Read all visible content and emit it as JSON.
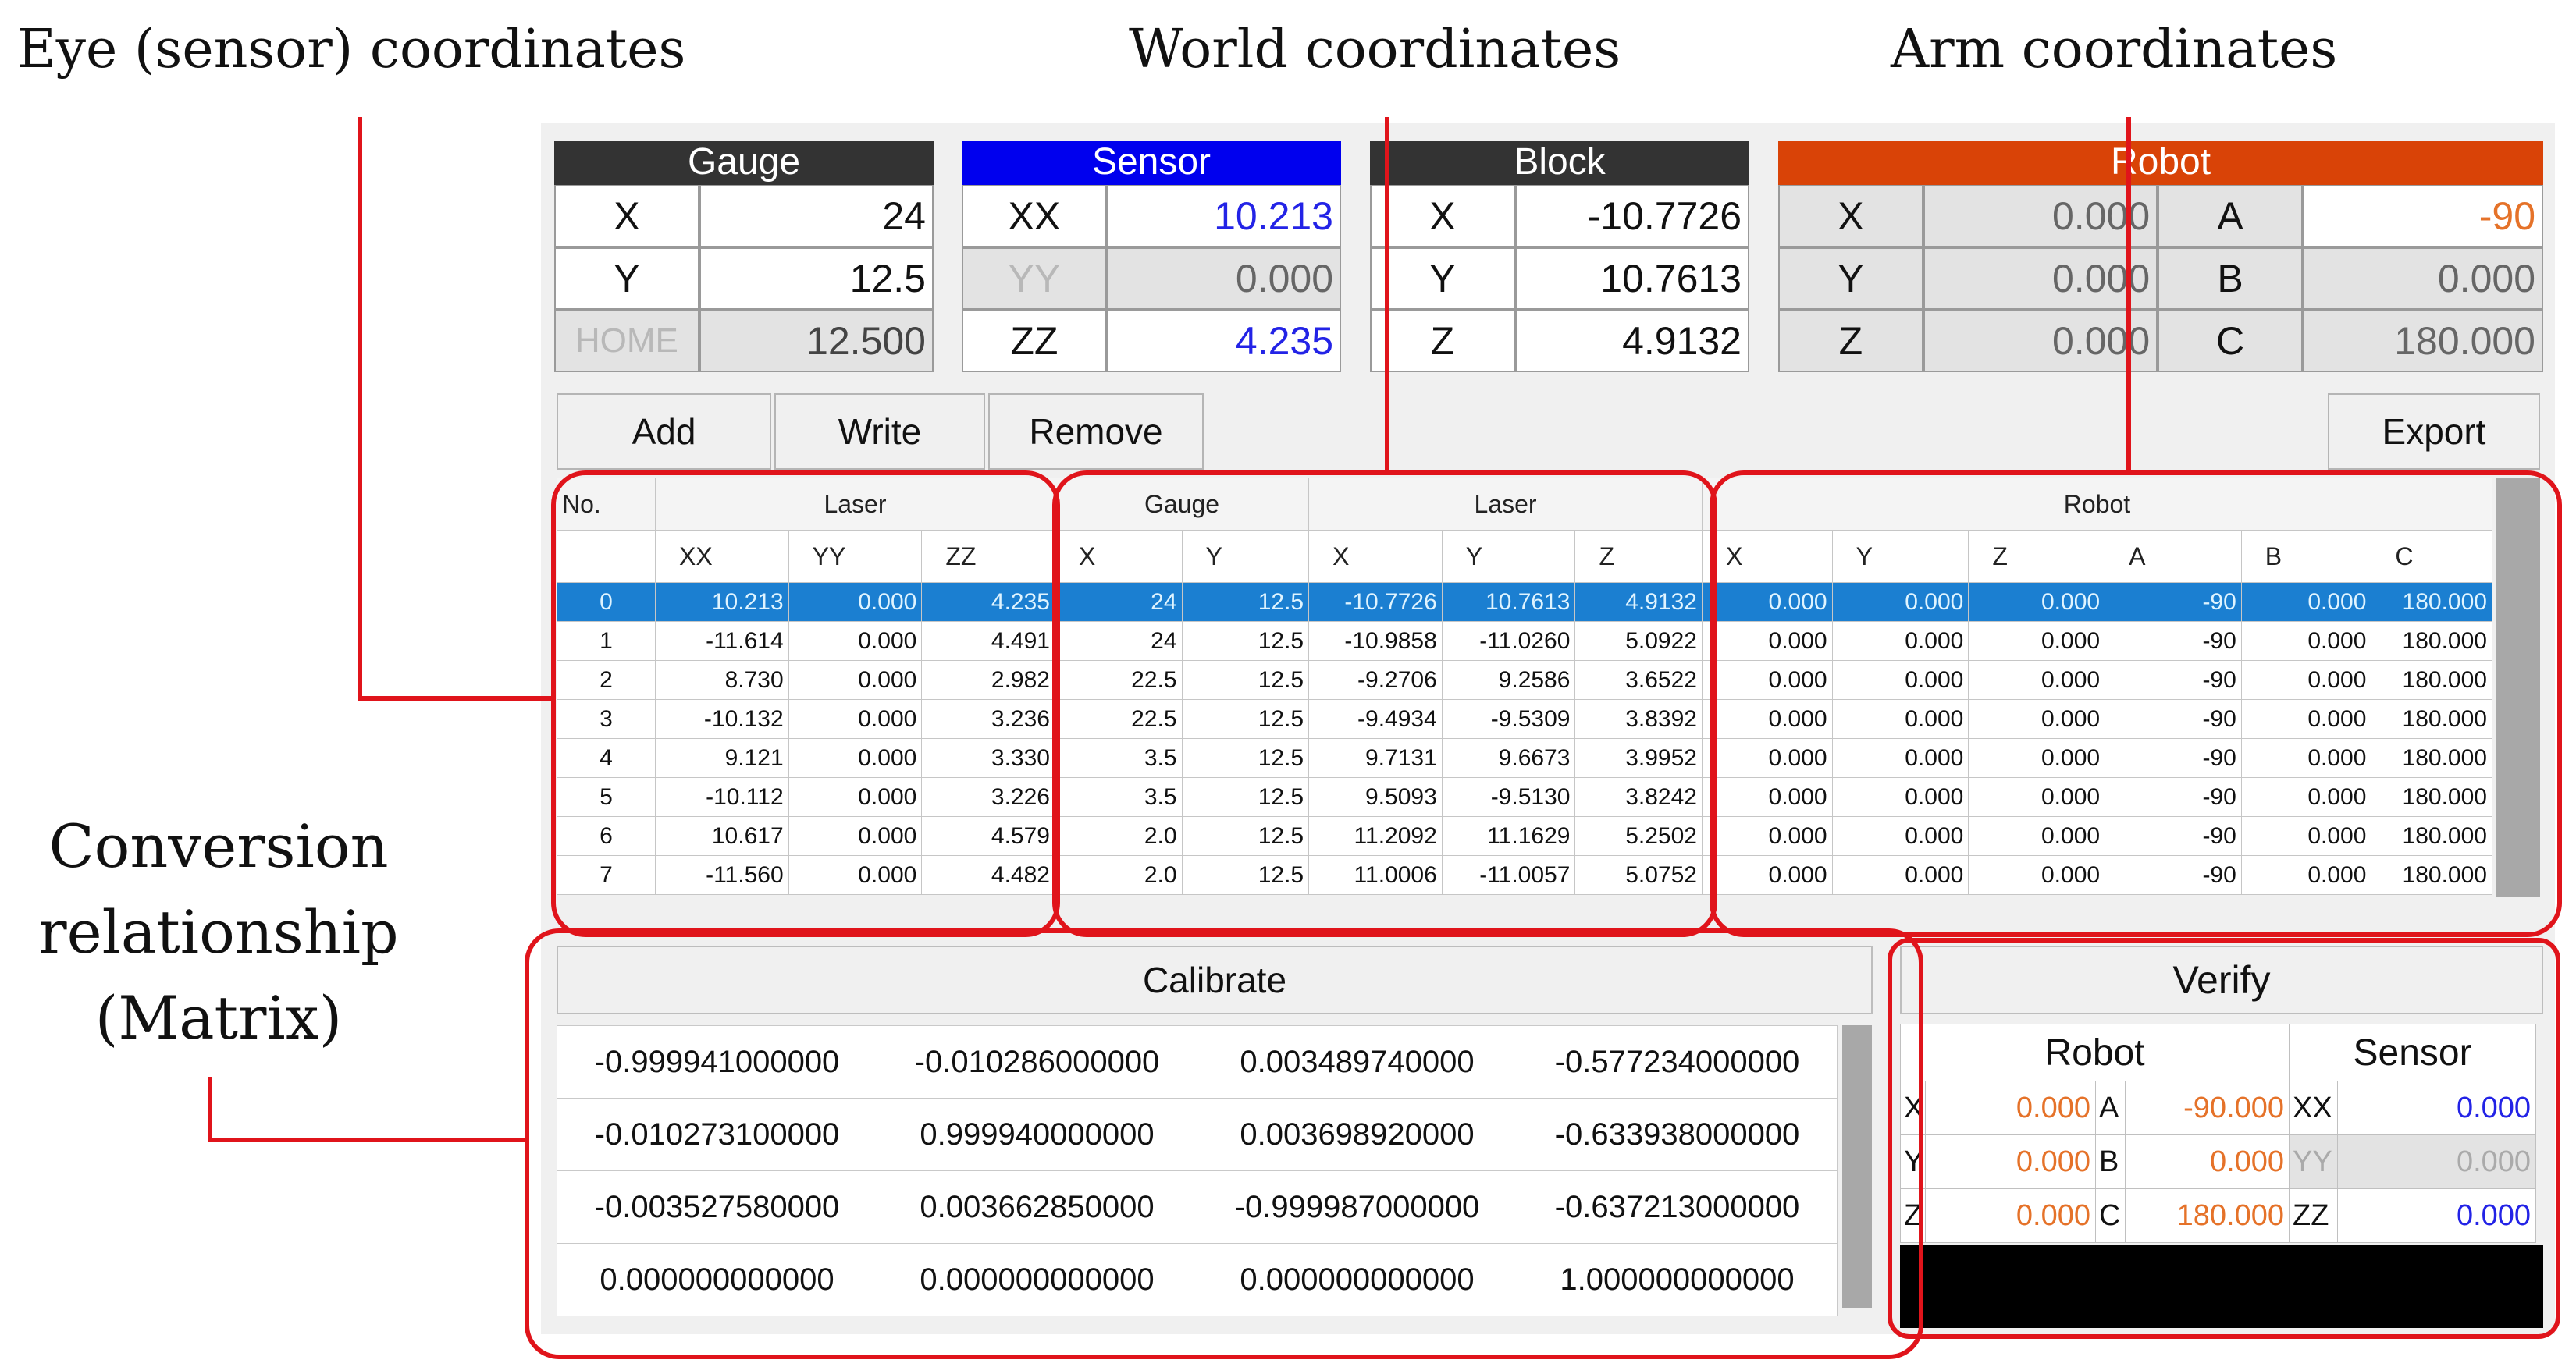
{
  "annotations": {
    "eye": "Eye (sensor) coordinates",
    "world": "World coordinates",
    "arm": "Arm coordinates",
    "conversion": [
      "Conversion",
      "relationship",
      "(Matrix)"
    ]
  },
  "colors": {
    "sensor_header": "#0000ee",
    "robot_header": "#d94307",
    "selected_row": "#1b7fd1",
    "callout": "#e0141b"
  },
  "gauge": {
    "title": "Gauge",
    "x_label": "X",
    "x": "24",
    "y_label": "Y",
    "y": "12.5",
    "home_label": "HOME",
    "home": "12.500"
  },
  "sensor": {
    "title": "Sensor",
    "xx_label": "XX",
    "xx": "10.213",
    "yy_label": "YY",
    "yy": "0.000",
    "zz_label": "ZZ",
    "zz": "4.235"
  },
  "block": {
    "title": "Block",
    "x_label": "X",
    "x": "-10.7726",
    "y_label": "Y",
    "y": "10.7613",
    "z_label": "Z",
    "z": "4.9132"
  },
  "robot": {
    "title": "Robot",
    "x_label": "X",
    "x": "0.000",
    "y_label": "Y",
    "y": "0.000",
    "z_label": "Z",
    "z": "0.000",
    "a_label": "A",
    "a": "-90",
    "b_label": "B",
    "b": "0.000",
    "c_label": "C",
    "c": "180.000"
  },
  "toolbar": {
    "add": "Add",
    "write": "Write",
    "remove": "Remove",
    "export": "Export"
  },
  "table": {
    "groups": {
      "no": "No.",
      "laser": "Laser",
      "gauge": "Gauge",
      "laser2": "Laser",
      "robot": "Robot"
    },
    "columns": [
      "XX",
      "YY",
      "ZZ",
      "X",
      "Y",
      "X",
      "Y",
      "Z",
      "X",
      "Y",
      "Z",
      "A",
      "B",
      "C"
    ],
    "rows": [
      [
        "0",
        "10.213",
        "0.000",
        "4.235",
        "24",
        "12.5",
        "-10.7726",
        "10.7613",
        "4.9132",
        "0.000",
        "0.000",
        "0.000",
        "-90",
        "0.000",
        "180.000"
      ],
      [
        "1",
        "-11.614",
        "0.000",
        "4.491",
        "24",
        "12.5",
        "-10.9858",
        "-11.0260",
        "5.0922",
        "0.000",
        "0.000",
        "0.000",
        "-90",
        "0.000",
        "180.000"
      ],
      [
        "2",
        "8.730",
        "0.000",
        "2.982",
        "22.5",
        "12.5",
        "-9.2706",
        "9.2586",
        "3.6522",
        "0.000",
        "0.000",
        "0.000",
        "-90",
        "0.000",
        "180.000"
      ],
      [
        "3",
        "-10.132",
        "0.000",
        "3.236",
        "22.5",
        "12.5",
        "-9.4934",
        "-9.5309",
        "3.8392",
        "0.000",
        "0.000",
        "0.000",
        "-90",
        "0.000",
        "180.000"
      ],
      [
        "4",
        "9.121",
        "0.000",
        "3.330",
        "3.5",
        "12.5",
        "9.7131",
        "9.6673",
        "3.9952",
        "0.000",
        "0.000",
        "0.000",
        "-90",
        "0.000",
        "180.000"
      ],
      [
        "5",
        "-10.112",
        "0.000",
        "3.226",
        "3.5",
        "12.5",
        "9.5093",
        "-9.5130",
        "3.8242",
        "0.000",
        "0.000",
        "0.000",
        "-90",
        "0.000",
        "180.000"
      ],
      [
        "6",
        "10.617",
        "0.000",
        "4.579",
        "2.0",
        "12.5",
        "11.2092",
        "11.1629",
        "5.2502",
        "0.000",
        "0.000",
        "0.000",
        "-90",
        "0.000",
        "180.000"
      ],
      [
        "7",
        "-11.560",
        "0.000",
        "4.482",
        "2.0",
        "12.5",
        "11.0006",
        "-11.0057",
        "5.0752",
        "0.000",
        "0.000",
        "0.000",
        "-90",
        "0.000",
        "180.000"
      ]
    ]
  },
  "calibrate": {
    "title": "Calibrate",
    "matrix": [
      [
        "-0.999941000000",
        "-0.010286000000",
        "0.003489740000",
        "-0.577234000000"
      ],
      [
        "-0.010273100000",
        "0.999940000000",
        "0.003698920000",
        "-0.633938000000"
      ],
      [
        "-0.003527580000",
        "0.003662850000",
        "-0.999987000000",
        "-0.637213000000"
      ],
      [
        "0.000000000000",
        "0.000000000000",
        "0.000000000000",
        "1.000000000000"
      ]
    ]
  },
  "verify": {
    "title": "Verify",
    "robot_label": "Robot",
    "sensor_label": "Sensor",
    "rows": [
      {
        "k1": "X",
        "v1": "0.000",
        "k2": "A",
        "v2": "-90.000",
        "k3": "XX",
        "v3": "0.000"
      },
      {
        "k1": "Y",
        "v1": "0.000",
        "k2": "B",
        "v2": "0.000",
        "k3": "YY",
        "v3": "0.000"
      },
      {
        "k1": "Z",
        "v1": "0.000",
        "k2": "C",
        "v2": "180.000",
        "k3": "ZZ",
        "v3": "0.000"
      }
    ]
  }
}
